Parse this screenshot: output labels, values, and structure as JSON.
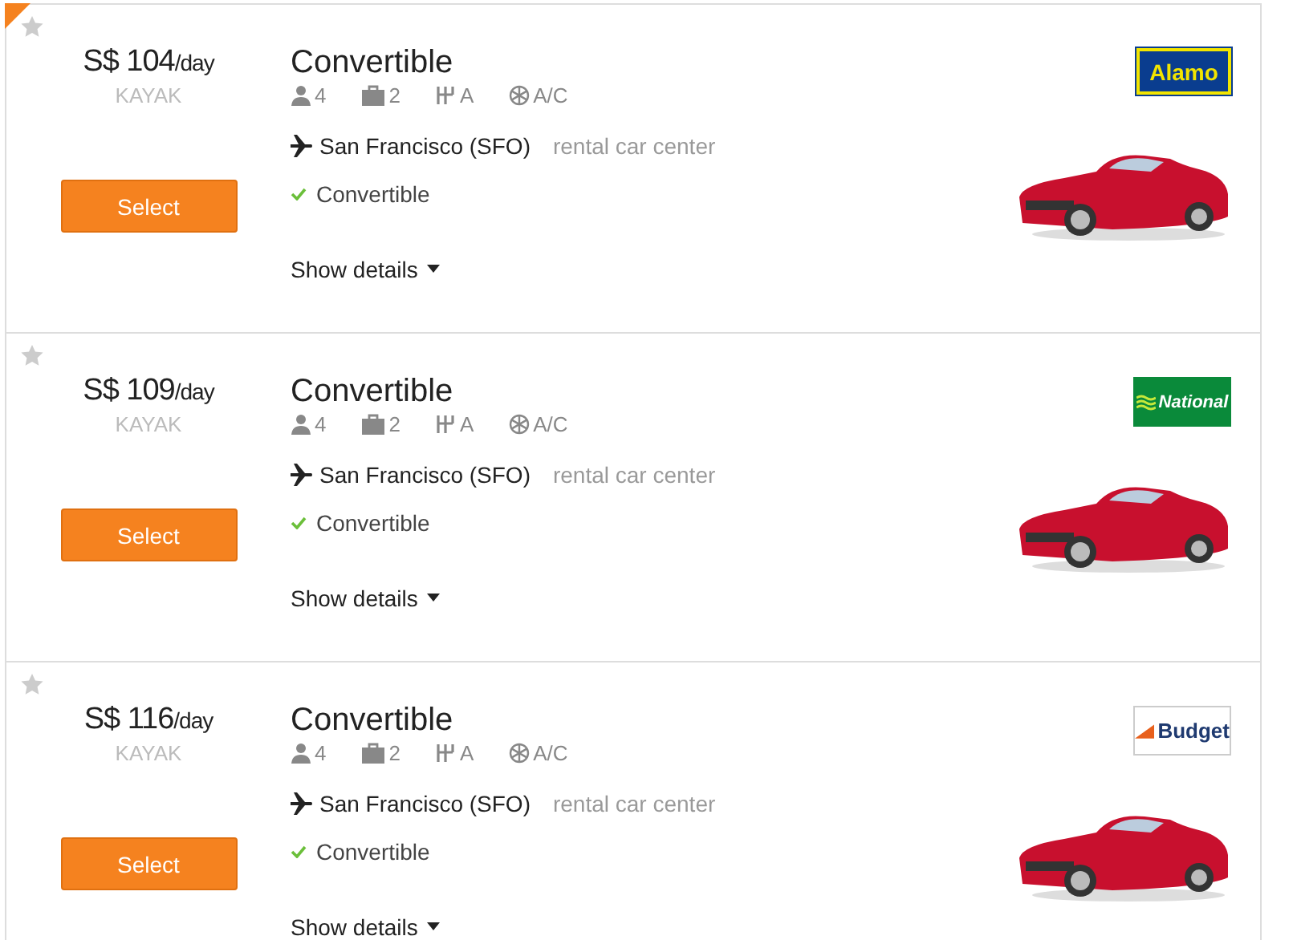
{
  "results": [
    {
      "featured": true,
      "favorite": false,
      "price": "S$ 104",
      "unit": "/day",
      "source": "KAYAK",
      "button": "Select",
      "title": "Convertible",
      "specs": [
        {
          "kind": "passengers",
          "text": "4"
        },
        {
          "kind": "bags",
          "text": "2"
        },
        {
          "kind": "transmission",
          "text": "A"
        },
        {
          "kind": "ac",
          "text": "A/C"
        }
      ],
      "location": "San Francisco (SFO)",
      "location_note": "rental car center",
      "feature": "Convertible",
      "details": "Show details",
      "logo": {
        "kind": "alamo",
        "text": "Alamo"
      }
    },
    {
      "featured": false,
      "favorite": false,
      "price": "S$ 109",
      "unit": "/day",
      "source": "KAYAK",
      "button": "Select",
      "title": "Convertible",
      "specs": [
        {
          "kind": "passengers",
          "text": "4"
        },
        {
          "kind": "bags",
          "text": "2"
        },
        {
          "kind": "transmission",
          "text": "A"
        },
        {
          "kind": "ac",
          "text": "A/C"
        }
      ],
      "location": "San Francisco (SFO)",
      "location_note": "rental car center",
      "feature": "Convertible",
      "details": "Show details",
      "logo": {
        "kind": "national",
        "text": "National"
      }
    },
    {
      "featured": false,
      "favorite": false,
      "price": "S$ 116",
      "unit": "/day",
      "source": "KAYAK",
      "button": "Select",
      "title": "Convertible",
      "specs": [
        {
          "kind": "passengers",
          "text": "4"
        },
        {
          "kind": "bags",
          "text": "2"
        },
        {
          "kind": "transmission",
          "text": "A"
        },
        {
          "kind": "ac",
          "text": "A/C"
        }
      ],
      "location": "San Francisco (SFO)",
      "location_note": "rental car center",
      "feature": "Convertible",
      "details": "Show details",
      "logo": {
        "kind": "budget",
        "text": "Budget"
      }
    }
  ]
}
